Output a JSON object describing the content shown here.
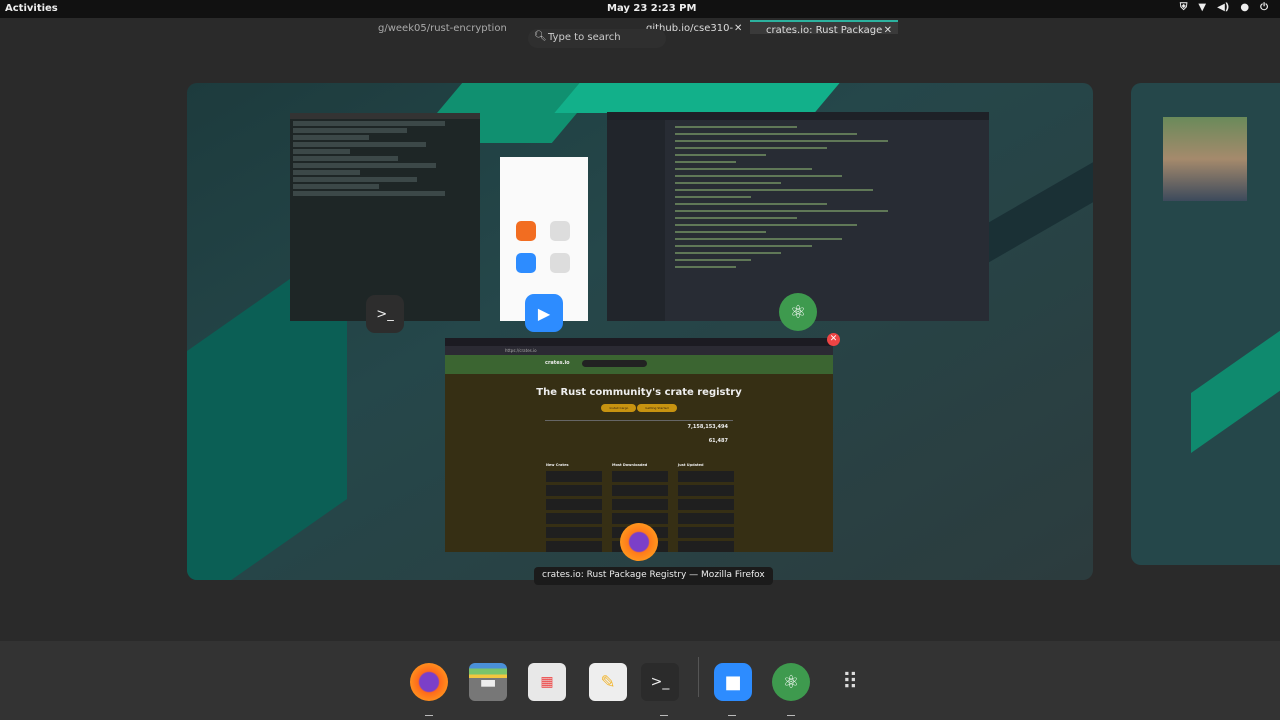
{
  "topbar": {
    "activities": "Activities",
    "clock": "May 23  2:23 PM"
  },
  "browser_tabs": {
    "tab1": "g/week05/rust-encryption",
    "tab2": "github.io/cse310-",
    "tab3": "crates.io: Rust Package"
  },
  "search": {
    "placeholder": "Type to search"
  },
  "crates_page": {
    "logo": "crates.io",
    "headline": "The Rust community's crate registry",
    "install_button": "Install Cargo",
    "getting_started_button": "Getting Started",
    "downloads": "7,158,153,494",
    "crates": "61,487",
    "columns": [
      {
        "title": "New Crates",
        "rows": [
          "",
          "",
          "",
          "",
          "",
          ""
        ]
      },
      {
        "title": "Most Downloaded",
        "rows": [
          "",
          "",
          "",
          "",
          "",
          ""
        ]
      },
      {
        "title": "Just Updated",
        "rows": [
          "",
          "",
          "",
          "",
          "",
          ""
        ]
      }
    ]
  },
  "caption": "crates.io: Rust Package Registry — Mozilla Firefox",
  "dock": [
    "Firefox",
    "Files",
    "Software",
    "Text Editor",
    "Terminal",
    "Zoom",
    "Atom",
    "Show Applications"
  ]
}
